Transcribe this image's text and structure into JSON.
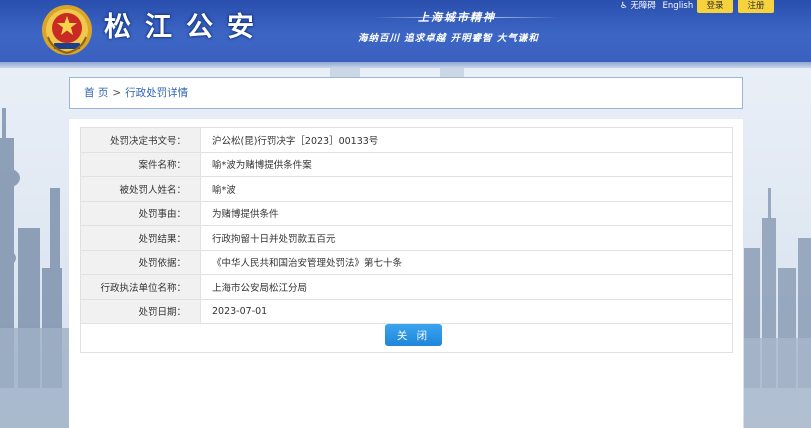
{
  "header": {
    "site_title": "松江公安",
    "slogan_title": "上海城市精神",
    "slogan_sub": "海纳百川 追求卓越 开明睿智 大气谦和",
    "accessibility_label": "无障碍",
    "english_label": "English",
    "login_label": "登录",
    "register_label": "注册"
  },
  "breadcrumb": {
    "home": "首 页",
    "separator": ">",
    "current": "行政处罚详情"
  },
  "detail": {
    "rows": [
      {
        "label": "处罚决定书文号：",
        "value": "沪公松(昆)行罚决字［2023］00133号"
      },
      {
        "label": "案件名称：",
        "value": "喻*波为赌博提供条件案"
      },
      {
        "label": "被处罚人姓名：",
        "value": "喻*波"
      },
      {
        "label": "处罚事由：",
        "value": "为赌博提供条件"
      },
      {
        "label": "处罚结果：",
        "value": "行政拘留十日并处罚款五百元"
      },
      {
        "label": "处罚依据：",
        "value": "《中华人民共和国治安管理处罚法》第七十条"
      },
      {
        "label": "行政执法单位名称：",
        "value": "上海市公安局松江分局"
      },
      {
        "label": "处罚日期：",
        "value": "2023-07-01"
      }
    ],
    "close_label": "关 闭"
  },
  "colors": {
    "header_blue": "#3a60bf",
    "button_yellow": "#f6d33c",
    "close_blue": "#1f86da",
    "link_blue": "#2f63b6"
  }
}
